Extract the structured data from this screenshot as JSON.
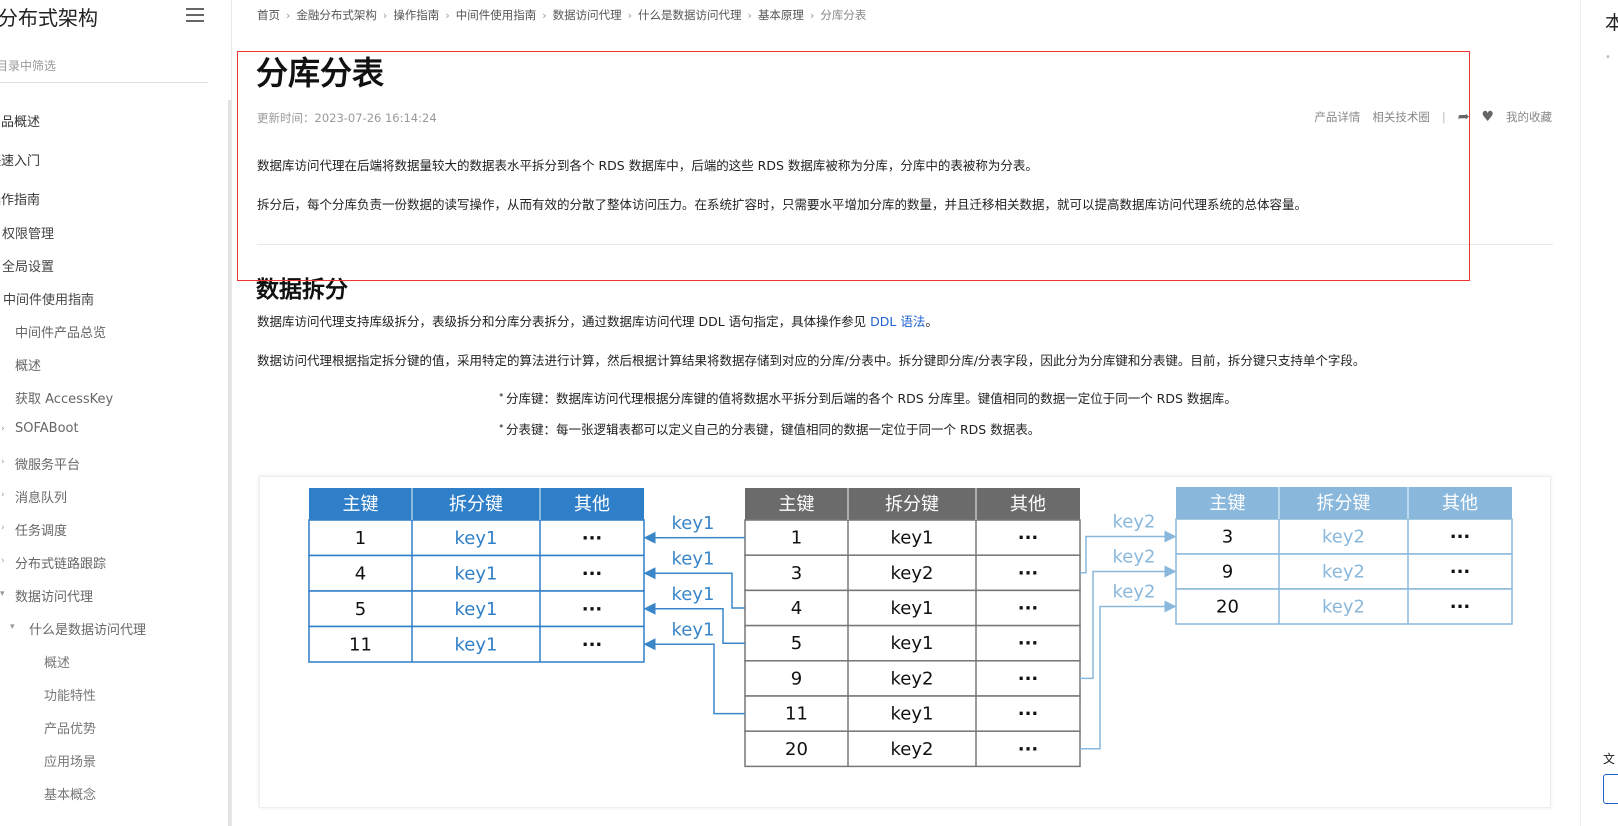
{
  "sidebar": {
    "title": "分布式架构",
    "filter_placeholder": "目录中筛选",
    "items": [
      {
        "label": "产品概述"
      },
      {
        "label": "快速入门"
      },
      {
        "label": "操作指南"
      },
      {
        "label": "权限管理"
      },
      {
        "label": "全局设置"
      },
      {
        "label": "中间件使用指南"
      },
      {
        "label": "中间件产品总览"
      },
      {
        "label": "概述"
      },
      {
        "label": "获取 AccessKey"
      },
      {
        "label": "SOFABoot"
      },
      {
        "label": "微服务平台"
      },
      {
        "label": "消息队列"
      },
      {
        "label": "任务调度"
      },
      {
        "label": "分布式链路跟踪"
      },
      {
        "label": "数据访问代理"
      },
      {
        "label": "什么是数据访问代理"
      },
      {
        "label": "概述"
      },
      {
        "label": "功能特性"
      },
      {
        "label": "产品优势"
      },
      {
        "label": "应用场景"
      },
      {
        "label": "基本概念"
      }
    ]
  },
  "breadcrumb": [
    "首页",
    "金融分布式架构",
    "操作指南",
    "中间件使用指南",
    "数据访问代理",
    "什么是数据访问代理",
    "基本原理",
    "分库分表"
  ],
  "page": {
    "title": "分库分表",
    "updated": "更新时间：2023-07-26 16:14:24",
    "toolbar": {
      "product_detail": "产品详情",
      "related_forum": "相关技术圈",
      "favorite": "我的收藏"
    },
    "intro_1": "数据库访问代理在后端将数据量较大的数据表水平拆分到各个 RDS 数据库中，后端的这些 RDS 数据库被称为分库，分库中的表被称为分表。",
    "intro_2": "拆分后，每个分库负责一份数据的读写操作，从而有效的分散了整体访问压力。在系统扩容时，只需要水平增加分库的数量，并且迁移相关数据，就可以提高数据库访问代理系统的总体容量。",
    "section_title": "数据拆分",
    "split_text_before": "数据库访问代理支持库级拆分，表级拆分和分库分表拆分，通过数据库访问代理 DDL 语句指定，具体操作参见 ",
    "split_link": "DDL 语法",
    "split_text_after": "。",
    "algo_text": "数据访问代理根据指定拆分键的值，采用特定的算法进行计算，然后根据计算结果将数据存储到对应的分库/分表中。拆分键即分库/分表字段，因此分为分库键和分表键。目前，拆分键只支持单个字段。",
    "bullets": [
      "分库键：数据库访问代理根据分库键的值将数据水平拆分到后端的各个 RDS 分库里。键值相同的数据一定位于同一个 RDS 数据库。",
      "分表键：每一张逻辑表都可以定义自己的分表键，键值相同的数据一定位于同一个 RDS 数据表。"
    ]
  },
  "diagram": {
    "headers": [
      "主键",
      "拆分键",
      "其他"
    ],
    "ellipsis": "···",
    "left_rows": [
      [
        "1",
        "key1"
      ],
      [
        "4",
        "key1"
      ],
      [
        "5",
        "key1"
      ],
      [
        "11",
        "key1"
      ]
    ],
    "center_rows": [
      [
        "1",
        "key1"
      ],
      [
        "3",
        "key2"
      ],
      [
        "4",
        "key1"
      ],
      [
        "5",
        "key1"
      ],
      [
        "9",
        "key2"
      ],
      [
        "11",
        "key1"
      ],
      [
        "20",
        "key2"
      ]
    ],
    "right_rows": [
      [
        "3",
        "key2"
      ],
      [
        "9",
        "key2"
      ],
      [
        "20",
        "key2"
      ]
    ],
    "left_arrow_labels": [
      "key1",
      "key1",
      "key1",
      "key1"
    ],
    "right_arrow_labels": [
      "key2",
      "key2",
      "key2"
    ],
    "colors": {
      "left_header": "#2f7fc8",
      "center_header": "#6b6b6b",
      "right_header": "#8ab8dc",
      "left_key": "#2f7fc8",
      "right_key": "#8ab8dc",
      "left_arrow": "#3a86c8",
      "right_arrow": "#8ab8dc"
    }
  },
  "right_panel": {
    "title": "本",
    "label": "文"
  }
}
